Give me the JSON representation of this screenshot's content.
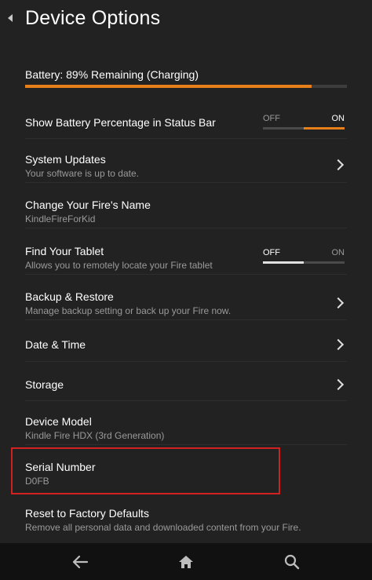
{
  "header": {
    "title": "Device Options"
  },
  "battery": {
    "label": "Battery: 89% Remaining (Charging)",
    "level_percent": 89
  },
  "settings": {
    "show_battery": {
      "title": "Show Battery Percentage in Status Bar",
      "toggle_off": "OFF",
      "toggle_on": "ON",
      "state": "on"
    },
    "system_updates": {
      "title": "System Updates",
      "subtitle": "Your software is up to date."
    },
    "fire_name": {
      "title": "Change Your Fire's Name",
      "subtitle": "KindleFireForKid"
    },
    "find_tablet": {
      "title": "Find Your Tablet",
      "subtitle": "Allows you to remotely locate your Fire tablet",
      "toggle_off": "OFF",
      "toggle_on": "ON",
      "state": "off"
    },
    "backup": {
      "title": "Backup & Restore",
      "subtitle": "Manage backup setting or back up your Fire now."
    },
    "date_time": {
      "title": "Date & Time"
    },
    "storage": {
      "title": "Storage"
    },
    "device_model": {
      "title": "Device Model",
      "subtitle": "Kindle Fire HDX (3rd Generation)"
    },
    "serial": {
      "title": "Serial Number",
      "subtitle": "D0FB"
    },
    "reset": {
      "title": "Reset to Factory Defaults",
      "subtitle": "Remove all personal data and downloaded content from your Fire."
    }
  },
  "colors": {
    "accent": "#e8801a",
    "highlight_box": "#d02020",
    "background": "#222222"
  },
  "navbar": {
    "icons": [
      "back-icon",
      "home-icon",
      "search-icon"
    ]
  }
}
